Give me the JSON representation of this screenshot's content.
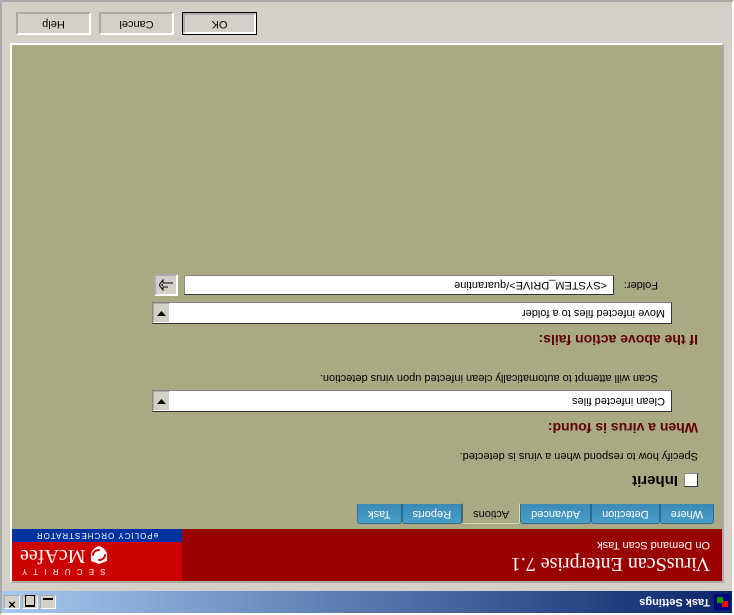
{
  "window": {
    "title": "Task Settings"
  },
  "header": {
    "product": "VirusScan Enterprise 7.1",
    "task": "On Demand Scan Task",
    "security_word": "S E C U R I T Y",
    "brand": "McAfee",
    "epo": "ePOLICY ORCHESTRATOR"
  },
  "tabs": [
    "Where",
    "Detection",
    "Advanced",
    "Actions",
    "Reports",
    "Task"
  ],
  "active_tab_index": 3,
  "body": {
    "inherit_label": "Inherit",
    "intro": "Specify how to respond when a virus is detected.",
    "when_found_title": "When a virus is found:",
    "primary_action": "Clean infected files",
    "primary_desc": "Scan will attempt to automatically clean infected upon virus detection.",
    "fails_title": "If the above action fails:",
    "secondary_action": "Move infected files to a folder",
    "folder_label": "Folder:",
    "folder_value": "<SYSTEM_DRIVE>/quarantine"
  },
  "buttons": {
    "ok": "OK",
    "cancel": "Cancel",
    "help": "Help"
  }
}
